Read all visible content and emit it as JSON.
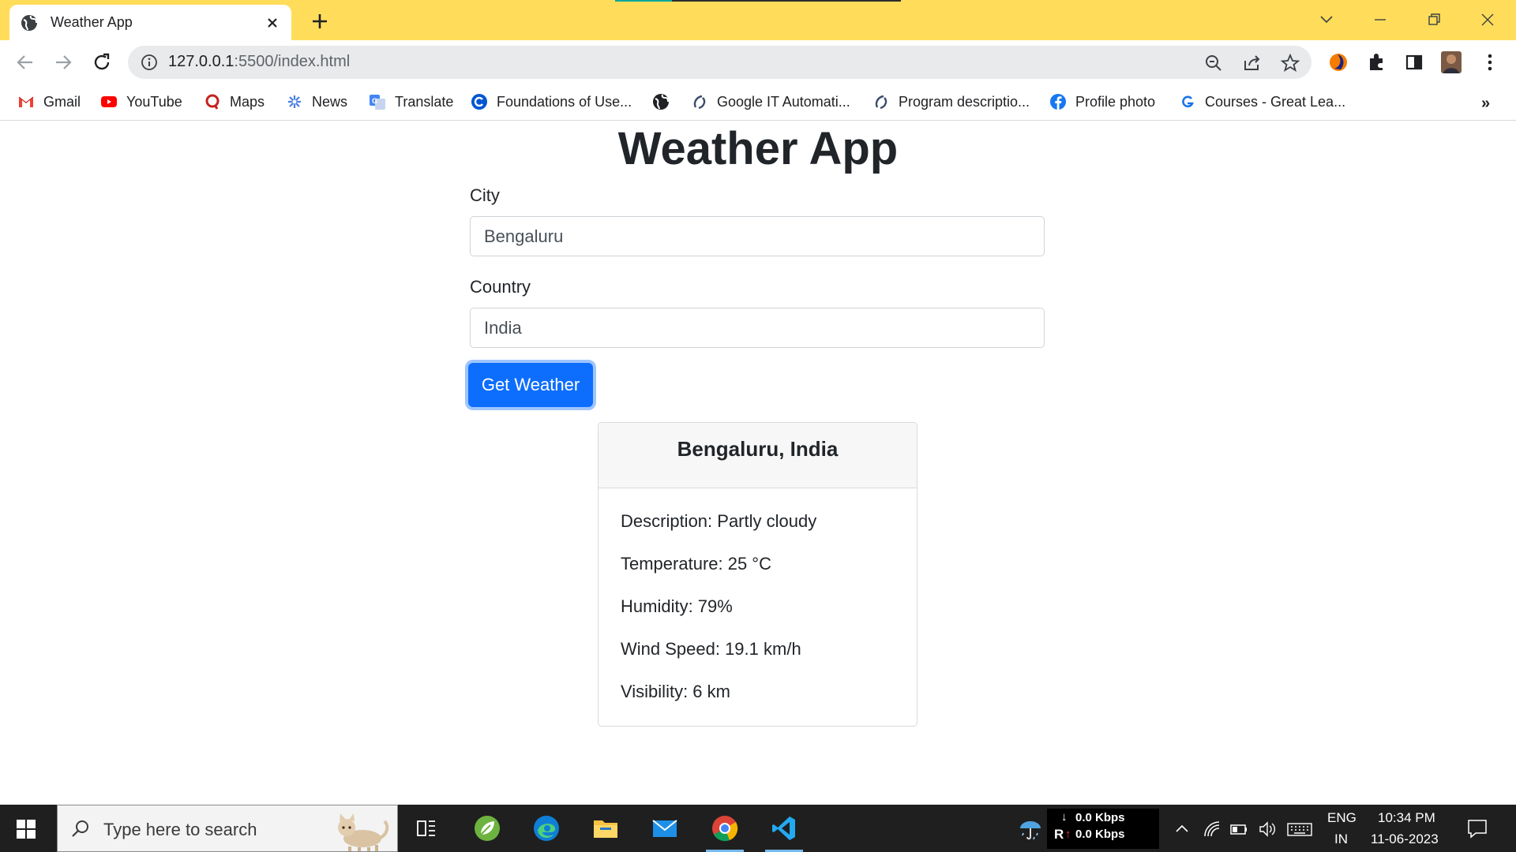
{
  "browser": {
    "tab_title": "Weather App",
    "url_host": "127.0.0.1",
    "url_rest": ":5500/index.html",
    "bookmarks": [
      {
        "label": "Gmail",
        "icon": "gmail-icon"
      },
      {
        "label": "YouTube",
        "icon": "youtube-icon"
      },
      {
        "label": "Maps",
        "icon": "maps-icon"
      },
      {
        "label": "News",
        "icon": "news-icon"
      },
      {
        "label": "Translate",
        "icon": "translate-icon"
      },
      {
        "label": "Foundations of Use...",
        "icon": "coursera-icon"
      },
      {
        "label": "",
        "icon": "globe-icon"
      },
      {
        "label": "Google IT Automati...",
        "icon": "bookmark-icon"
      },
      {
        "label": "Program descriptio...",
        "icon": "bookmark-icon"
      },
      {
        "label": "Profile photo",
        "icon": "facebook-icon"
      },
      {
        "label": "Courses - Great Lea...",
        "icon": "great-learning-icon"
      }
    ],
    "more_bookmarks": "»"
  },
  "app": {
    "title": "Weather App",
    "city_label": "City",
    "city_value": "Bengaluru",
    "country_label": "Country",
    "country_value": "India",
    "button_label": "Get Weather"
  },
  "weather": {
    "location": "Bengaluru, India",
    "description": "Description: Partly cloudy",
    "temperature": "Temperature: 25 °C",
    "humidity": "Humidity: 79%",
    "wind_speed": "Wind Speed: 19.1 km/h",
    "visibility": "Visibility: 6 km"
  },
  "taskbar": {
    "search_placeholder": "Type here to search",
    "net_down": "0.0 Kbps",
    "net_up": "0.0 Kbps",
    "net_up_prefix": "R",
    "lang_top": "ENG",
    "lang_bottom": "IN",
    "time": "10:34 PM",
    "date": "11-06-2023"
  },
  "colors": {
    "titlebar": "#ffdd5a",
    "primary_button": "#0d6efd",
    "taskbar": "#1f1f1f"
  }
}
